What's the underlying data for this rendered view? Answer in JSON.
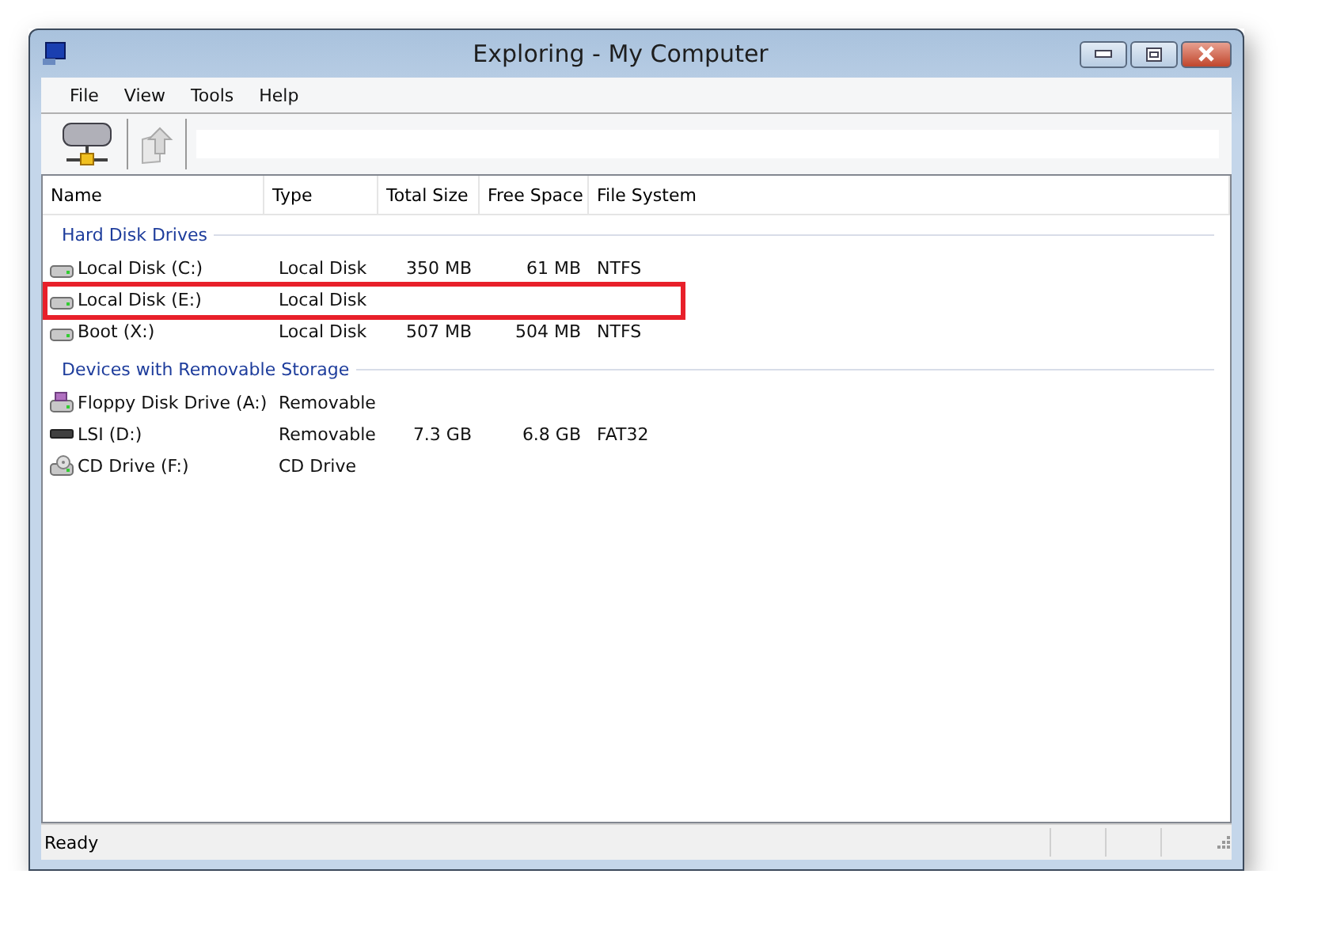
{
  "window": {
    "title": "Exploring - My Computer"
  },
  "menu": [
    "File",
    "View",
    "Tools",
    "Help"
  ],
  "columns": [
    "Name",
    "Type",
    "Total Size",
    "Free Space",
    "File System"
  ],
  "groups": [
    {
      "title": "Hard Disk Drives",
      "items": [
        {
          "kind": "hdd",
          "name": "Local Disk (C:)",
          "type": "Local Disk",
          "total": "350 MB",
          "free": "61 MB",
          "fs": "NTFS",
          "highlighted": false
        },
        {
          "kind": "hdd",
          "name": "Local Disk (E:)",
          "type": "Local Disk",
          "highlighted": true
        },
        {
          "kind": "hdd",
          "name": "Boot (X:)",
          "type": "Local Disk",
          "total": "507 MB",
          "free": "504 MB",
          "fs": "NTFS",
          "highlighted": false
        }
      ]
    },
    {
      "title": "Devices with Removable Storage",
      "items": [
        {
          "kind": "floppy",
          "name": "Floppy Disk Drive (A:)",
          "type": "Removable",
          "highlighted": false
        },
        {
          "kind": "removable",
          "name": "LSI (D:)",
          "type": "Removable",
          "total": "7.3 GB",
          "free": "6.8 GB",
          "fs": "FAT32",
          "highlighted": false
        },
        {
          "kind": "cd",
          "name": "CD Drive (F:)",
          "type": "CD Drive",
          "highlighted": false
        }
      ]
    }
  ],
  "status_bar": "Ready"
}
